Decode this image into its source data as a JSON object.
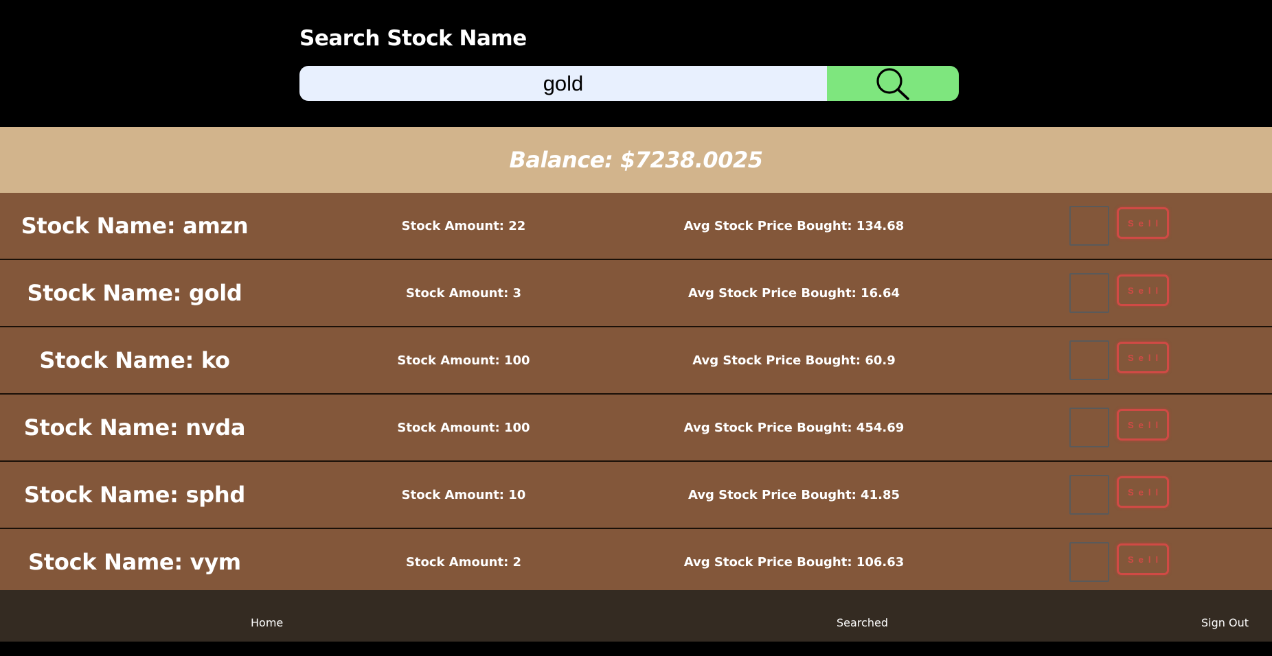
{
  "search": {
    "title": "Search Stock Name",
    "value": "gold",
    "button_icon": "search-icon"
  },
  "balance": {
    "text": "Balance: $7238.0025"
  },
  "stocks": [
    {
      "name": "Stock Name: amzn",
      "amount": "Stock Amount: 22",
      "avg": "Avg Stock Price Bought: 134.68",
      "qty": "",
      "sell_label": "Sell"
    },
    {
      "name": "Stock Name: gold",
      "amount": "Stock Amount: 3",
      "avg": "Avg Stock Price Bought: 16.64",
      "qty": "",
      "sell_label": "Sell"
    },
    {
      "name": "Stock Name: ko",
      "amount": "Stock Amount: 100",
      "avg": "Avg Stock Price Bought: 60.9",
      "qty": "",
      "sell_label": "Sell"
    },
    {
      "name": "Stock Name: nvda",
      "amount": "Stock Amount: 100",
      "avg": "Avg Stock Price Bought: 454.69",
      "qty": "",
      "sell_label": "Sell"
    },
    {
      "name": "Stock Name: sphd",
      "amount": "Stock Amount: 10",
      "avg": "Avg Stock Price Bought: 41.85",
      "qty": "",
      "sell_label": "Sell"
    },
    {
      "name": "Stock Name: vym",
      "amount": "Stock Amount: 2",
      "avg": "Avg Stock Price Bought: 106.63",
      "qty": "",
      "sell_label": "Sell"
    }
  ],
  "footer": {
    "home": "Home",
    "searched": "Searched",
    "sign_out": "Sign Out"
  },
  "colors": {
    "header_bg": "#000000",
    "search_input_bg": "#e8f0fe",
    "search_button_bg": "#7ee67e",
    "balance_bg": "#d2b48c",
    "row_bg": "#83573a",
    "sell_accent": "#d04a45",
    "footer_bg": "#342b22"
  }
}
